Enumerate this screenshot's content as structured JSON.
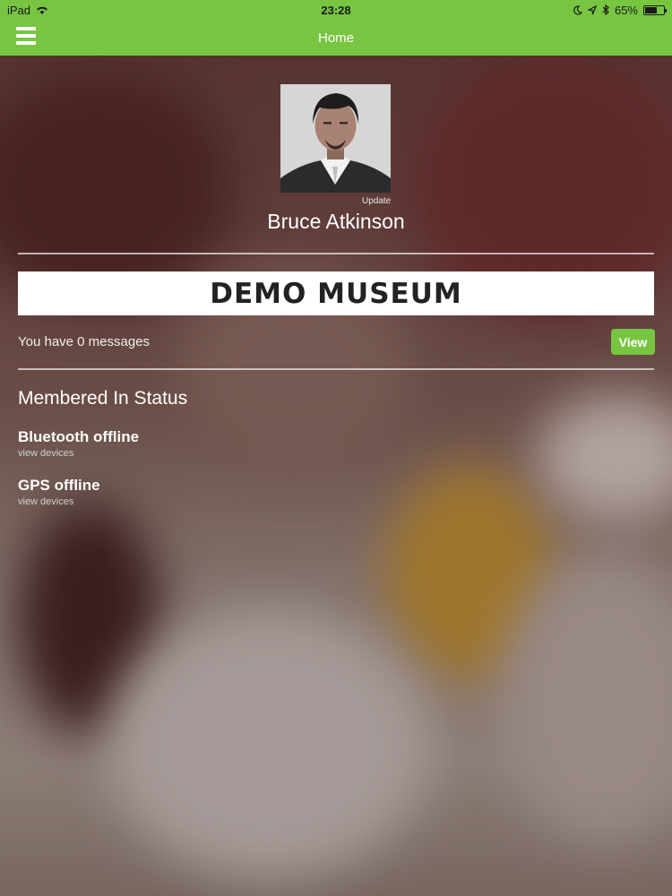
{
  "status_bar": {
    "device": "iPad",
    "time": "23:28",
    "battery": "65%",
    "battery_level": 0.65,
    "icons": [
      "wifi-icon",
      "moon-icon",
      "location-icon",
      "bluetooth-icon",
      "battery-icon"
    ]
  },
  "nav": {
    "title": "Home",
    "menu_icon": "hamburger-menu-icon"
  },
  "profile": {
    "update_label": "Update",
    "name": "Bruce Atkinson"
  },
  "banner": {
    "text": "DEMO MUSEUM"
  },
  "messages": {
    "text": "You have 0 messages",
    "button_label": "View"
  },
  "membered": {
    "title": "Membered In Status",
    "items": [
      {
        "label": "Bluetooth offline",
        "link": "view devices"
      },
      {
        "label": "GPS offline",
        "link": "view devices"
      }
    ]
  },
  "colors": {
    "accent": "#78c541"
  }
}
